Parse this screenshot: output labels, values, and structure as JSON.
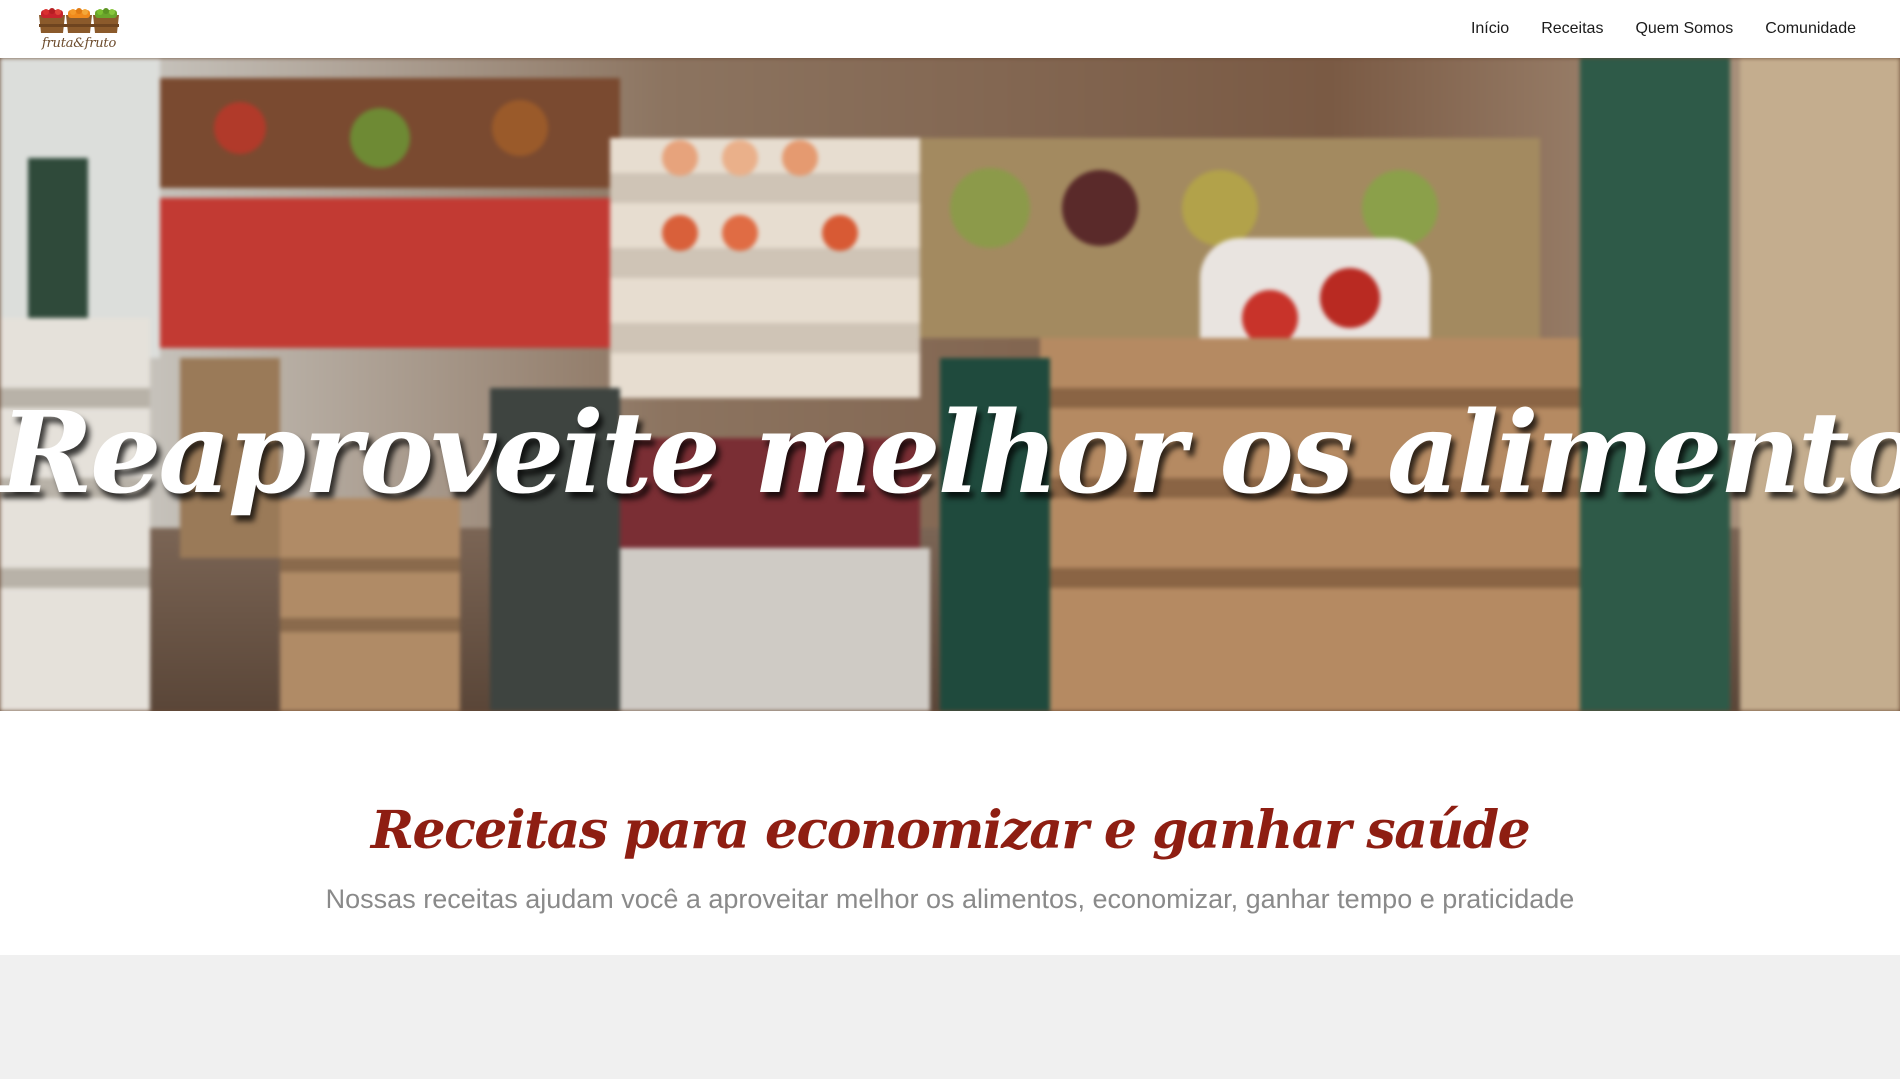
{
  "brand": {
    "logo_text": "fruta&fruto"
  },
  "nav": {
    "items": [
      {
        "label": "Início"
      },
      {
        "label": "Receitas"
      },
      {
        "label": "Quem Somos"
      },
      {
        "label": "Comunidade"
      }
    ]
  },
  "hero": {
    "title": "Reaproveite melhor os alimentos!"
  },
  "recipes_section": {
    "title": "Receitas para economizar e ganhar saúde",
    "subtitle": "Nossas receitas ajudam você a aproveitar melhor os alimentos, economizar, ganhar tempo e praticidade"
  },
  "colors": {
    "title_red": "#8e1e12",
    "subtitle_gray": "#8a8a8a",
    "band_gray": "#f0f0f0"
  }
}
